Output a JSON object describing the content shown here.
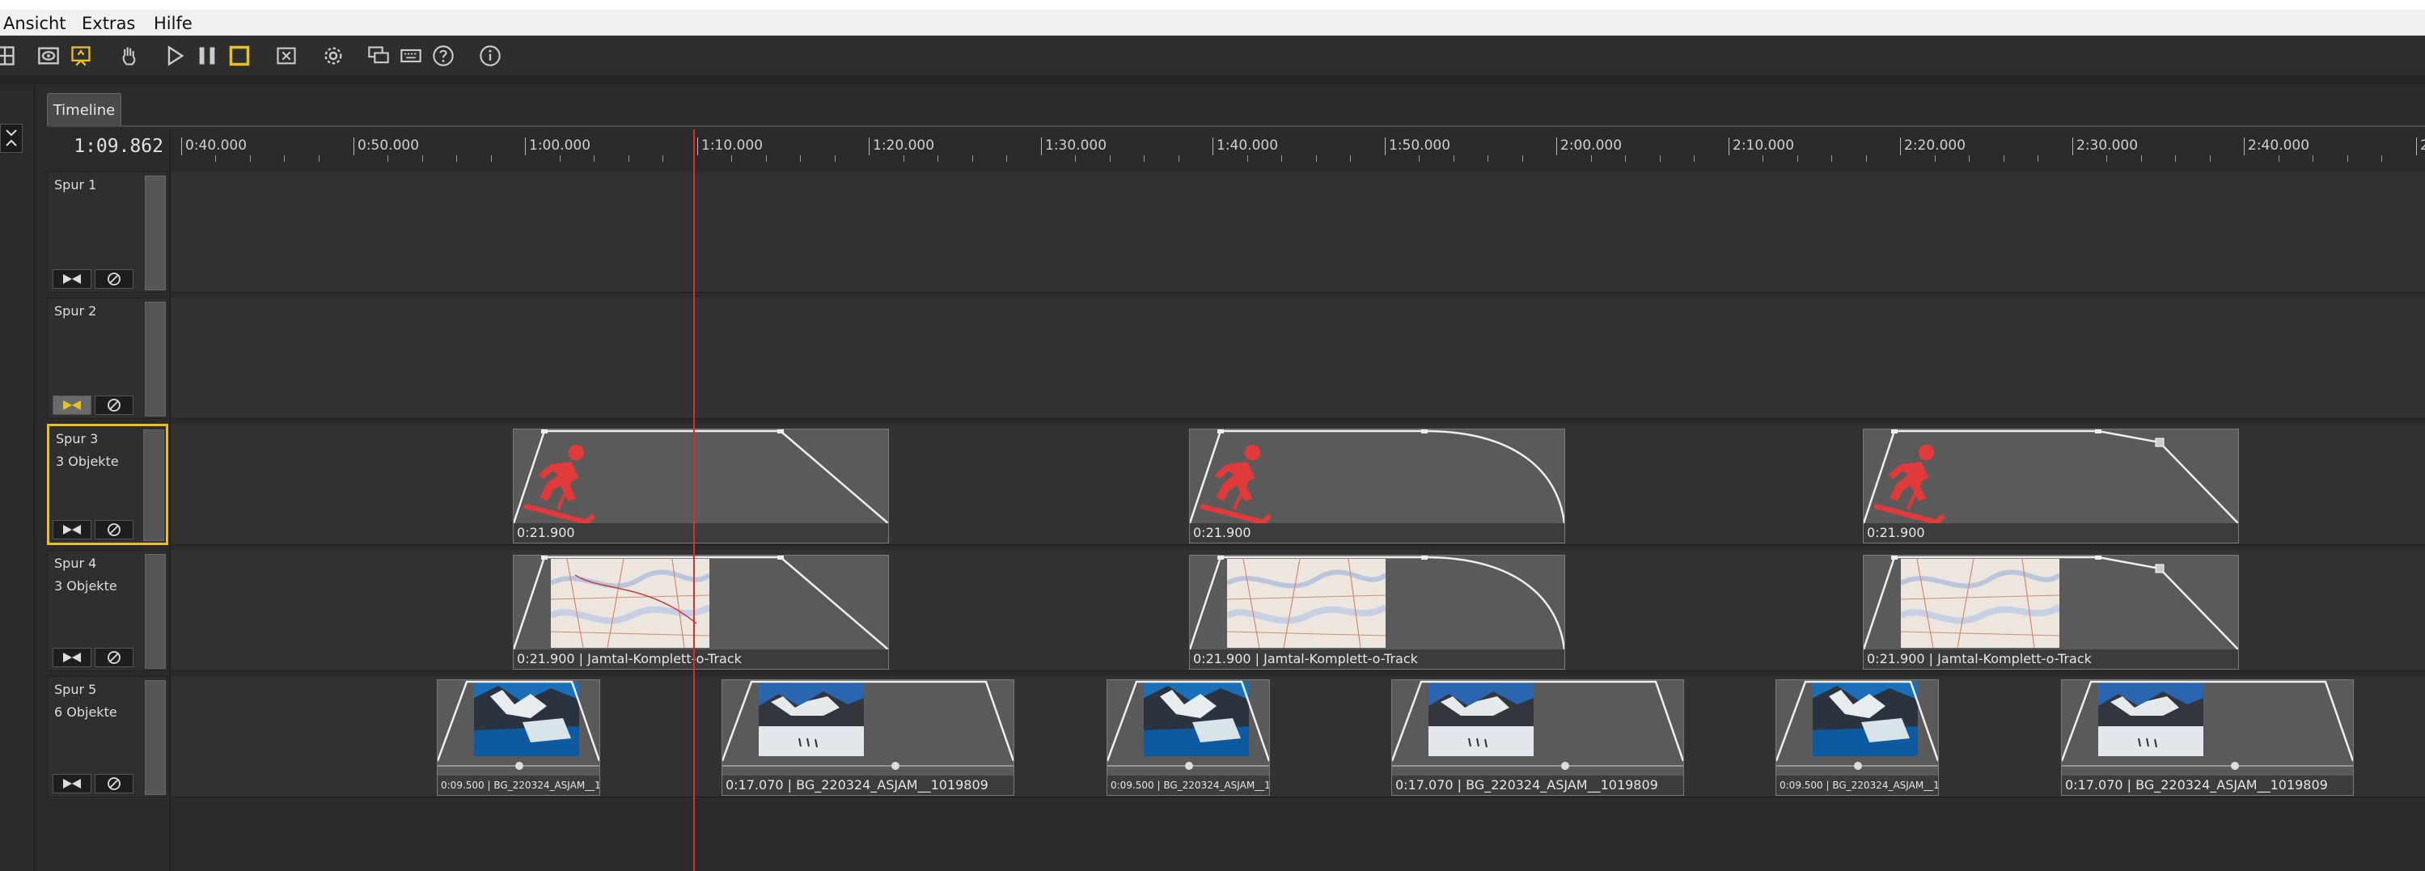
{
  "menu": {
    "items": [
      {
        "label": "Ansicht"
      },
      {
        "label": "Extras"
      },
      {
        "label": "Hilfe"
      }
    ]
  },
  "toolbar": {
    "icons": [
      "grid-icon",
      "eye-icon",
      "presentation-icon",
      "hand-icon",
      "play-icon",
      "pause-icon",
      "stop-icon",
      "close-box-icon",
      "gear-icon",
      "chat-icon",
      "keyboard-icon",
      "help-icon",
      "info-icon"
    ]
  },
  "timeline": {
    "tab_label": "Timeline",
    "current_time": "1:09.862",
    "ruler_labels": [
      "0:40.000",
      "0:50.000",
      "1:00.000",
      "1:10.000",
      "1:20.000",
      "1:30.000",
      "1:40.000",
      "1:50.000",
      "2:00.000",
      "2:10.000",
      "2:20.000",
      "2:30.000",
      "2:40.000",
      "2"
    ],
    "tracks": [
      {
        "name": "Spur 1",
        "count": ""
      },
      {
        "name": "Spur 2",
        "count": ""
      },
      {
        "name": "Spur 3",
        "count": "3 Objekte"
      },
      {
        "name": "Spur 4",
        "count": "3 Objekte"
      },
      {
        "name": "Spur 5",
        "count": "6 Objekte"
      }
    ],
    "spur3_clips": [
      {
        "label": "0:21.900"
      },
      {
        "label": "0:21.900"
      },
      {
        "label": "0:21.900"
      }
    ],
    "spur4_clips": [
      {
        "label": "0:21.900 | Jamtal-Komplett-o-Track"
      },
      {
        "label": "0:21.900 | Jamtal-Komplett-o-Track"
      },
      {
        "label": "0:21.900 | Jamtal-Komplett-o-Track"
      }
    ],
    "spur5_clips": [
      {
        "label": "0:09.500 | BG_220324_ASJAM__1..."
      },
      {
        "label": "0:17.070 | BG_220324_ASJAM__1019809"
      },
      {
        "label": "0:09.500 | BG_220324_ASJAM__1..."
      },
      {
        "label": "0:17.070 | BG_220324_ASJAM__1019809"
      },
      {
        "label": "0:09.500 | BG_220324_ASJAM__1..."
      },
      {
        "label": "0:17.070 | BG_220324_ASJAM__1019809"
      }
    ]
  },
  "colors": {
    "accent": "#e8c020",
    "playhead": "#d43030",
    "skier": "#e03a3a"
  }
}
